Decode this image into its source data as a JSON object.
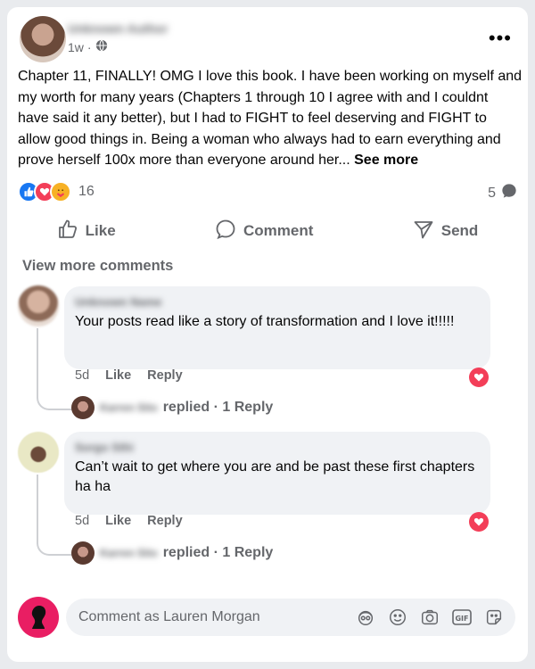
{
  "post": {
    "author": "Unknown Author",
    "time": "1w",
    "separator": "·",
    "body": "Chapter 11, FINALLY! OMG I love this book. I have been working on myself and my worth for many years (Chapters 1 through 10 I agree with and I couldnt have said it any better), but I had to FIGHT to feel deserving and FIGHT to allow good things in. Being a woman who always had to earn everything and prove herself 100x more than everyone around her...",
    "see_more": "See more",
    "reaction_count": "16",
    "comment_count": "5",
    "menu": "•••"
  },
  "actions": {
    "like": "Like",
    "comment": "Comment",
    "send": "Send"
  },
  "view_more_comments": "View more comments",
  "comments": [
    {
      "author": "Unknown Name",
      "text": "Your posts read like a story of transformation and I love it!!!!!",
      "time": "5d",
      "like": "Like",
      "reply": "Reply",
      "replies_label": "replied · 1 Reply",
      "reply_author": "Karren Sito"
    },
    {
      "author": "Sorgo Sthi",
      "text": "Can’t wait to get where you are and be past these first chapters ha ha",
      "time": "5d",
      "like": "Like",
      "reply": "Reply",
      "replies_label": "replied · 1 Reply",
      "reply_author": "Karren Sito"
    }
  ],
  "composer": {
    "placeholder": "Comment as Lauren Morgan"
  },
  "colors": {
    "brand": "#1877f2",
    "love": "#f33e58",
    "care": "#f7b125",
    "composer_avatar": "#e91e63"
  }
}
